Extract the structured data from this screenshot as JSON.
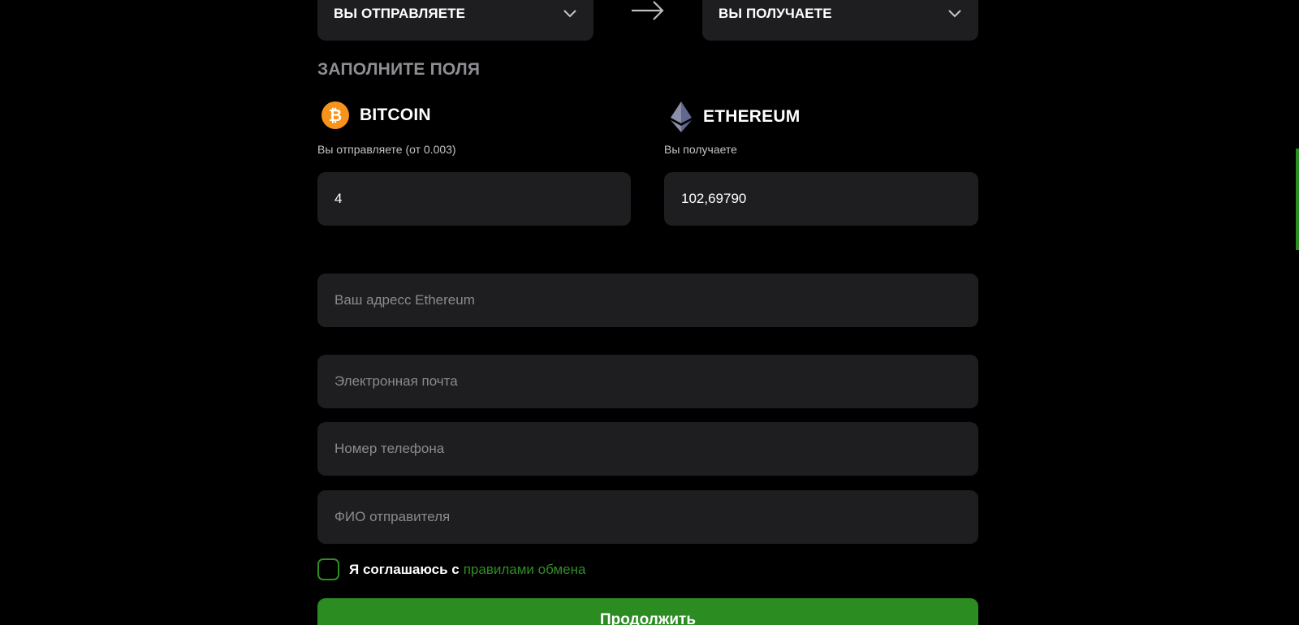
{
  "exchange": {
    "send_select_label": "ВЫ ОТПРАВЛЯЕТЕ",
    "receive_select_label": "ВЫ ПОЛУЧАЕТЕ",
    "section_title": "ЗАПОЛНИТЕ ПОЛЯ",
    "send_coin": {
      "name": "BITCOIN",
      "sub": "Вы отправляете (от 0.003)",
      "amount": "4",
      "color": "#f7931a"
    },
    "receive_coin": {
      "name": "ETHEREUM",
      "sub": "Вы получаете",
      "amount": "102,69790"
    }
  },
  "form": {
    "address_placeholder": "Ваш адресс Ethereum",
    "email_placeholder": "Электронная почта",
    "phone_placeholder": "Номер телефона",
    "name_placeholder": "ФИО отправителя",
    "agree_text": "Я соглашаюсь с",
    "agree_link": "правилами обмена",
    "submit_label": "Продолжить"
  },
  "colors": {
    "accent": "#2b8c22",
    "field_bg": "#1e1e21",
    "background": "#000000"
  },
  "icons": {
    "send_select": "chevron-down-icon",
    "receive_select": "chevron-down-icon",
    "direction": "arrow-right-icon",
    "bitcoin": "bitcoin-icon",
    "ethereum": "ethereum-icon"
  }
}
